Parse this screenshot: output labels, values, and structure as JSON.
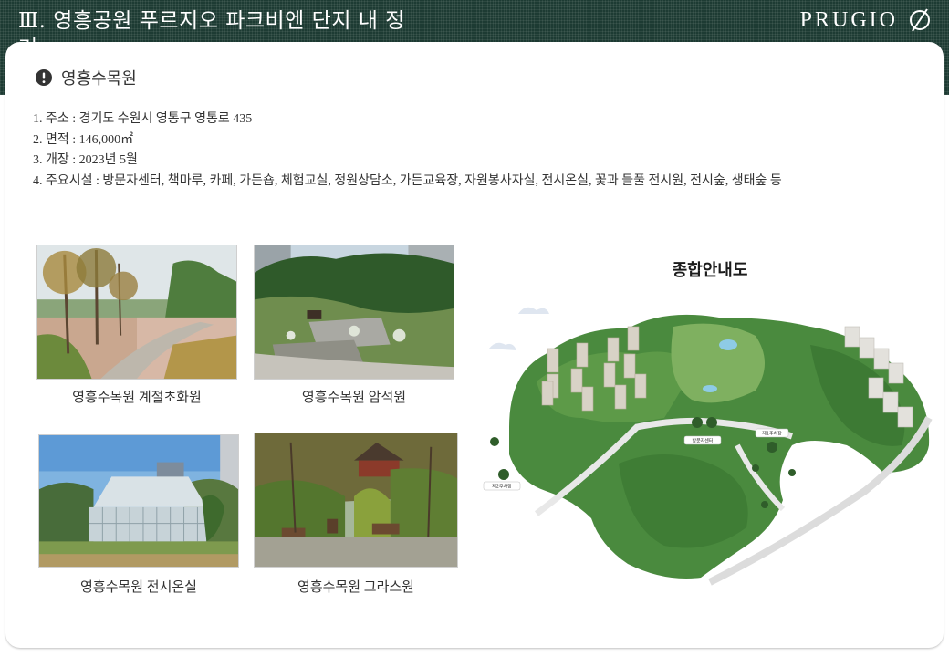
{
  "header": {
    "title": "Ⅲ. 영흥공원 푸르지오 파크비엔 단지 내 정거",
    "brand": "PRUGIO"
  },
  "section": {
    "title": "영흥수목원"
  },
  "info": [
    "1. 주소 : 경기도 수원시 영통구 영통로 435",
    "2. 면적 : 146,000㎡",
    "3. 개장 : 2023년 5월",
    "4. 주요시설 : 방문자센터, 책마루, 카페, 가든숍, 체험교실, 정원상담소, 가든교육장, 자원봉사자실, 전시온실, 꽃과 들풀 전시원, 전시숲, 생태숲 등"
  ],
  "photos": [
    {
      "caption": "영흥수목원 계절초화원",
      "icon": "seasonal-flower-garden-photo"
    },
    {
      "caption": "영흥수목원 암석원",
      "icon": "rock-garden-photo"
    },
    {
      "caption": "영흥수목원 전시온실",
      "icon": "greenhouse-photo"
    },
    {
      "caption": "영흥수목원 그라스원",
      "icon": "grass-garden-photo"
    }
  ],
  "map": {
    "title": "종합안내도",
    "labels": {
      "visitor_center": "방문자센터",
      "parking_1": "제1주차장",
      "parking_2": "제2주차장"
    }
  },
  "colors": {
    "header_bg": "#1d3b33",
    "forest": "#3f7a3a"
  }
}
